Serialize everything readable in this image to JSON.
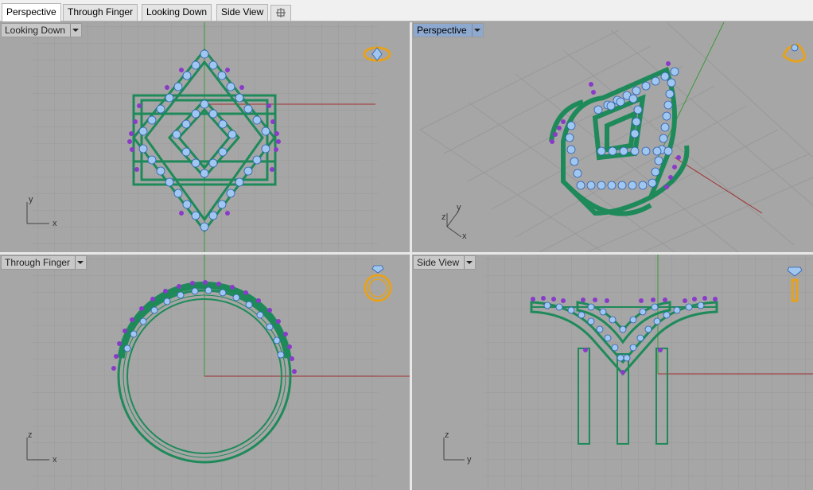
{
  "tabs": [
    {
      "label": "Perspective",
      "active": true
    },
    {
      "label": "Through Finger",
      "active": false
    },
    {
      "label": "Looking Down",
      "active": false
    },
    {
      "label": "Side View",
      "active": false
    }
  ],
  "viewports": {
    "top_left": {
      "title": "Looking Down",
      "axis_a": "y",
      "axis_b": "x",
      "active": false
    },
    "top_right": {
      "title": "Perspective",
      "axis_a": "z",
      "axis_b": "y",
      "axis_c": "x",
      "active": true
    },
    "bottom_left": {
      "title": "Through Finger",
      "axis_a": "z",
      "axis_b": "x",
      "active": false
    },
    "bottom_right": {
      "title": "Side View",
      "axis_a": "z",
      "axis_b": "y",
      "active": false
    }
  },
  "colors": {
    "viewport_bg": "#a6a6a6",
    "grid_minor": "#9a9a9a",
    "grid_major": "#8a8a8a",
    "x_axis": "#a03030",
    "y_axis": "#3a9a3a",
    "ring_wire": "#1e8a5a",
    "gem_fill": "#9fc7f0",
    "prong": "#8a3ac8",
    "widget": "#e6a21e"
  },
  "icons": [
    "ring-top-widget-icon",
    "ring-perspective-widget-icon",
    "ring-front-widget-icon",
    "ring-side-widget-icon",
    "add-tab-icon",
    "viewport-menu-dropdown-icon"
  ]
}
